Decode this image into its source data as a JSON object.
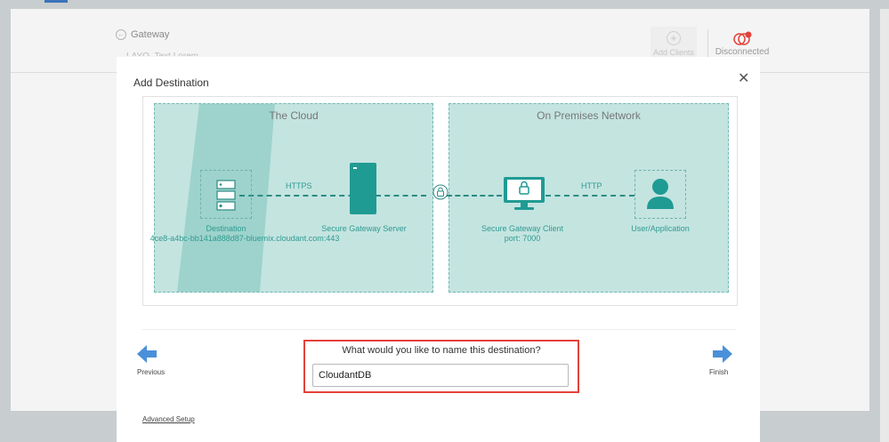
{
  "background": {
    "back_label": "Gateway",
    "subtitle_fragment": "LAYO_Text Lorem ... ",
    "add_client_label": "Add Clients",
    "status_label": "Disconnected"
  },
  "modal": {
    "title": "Add Destination",
    "close_glyph": "✕"
  },
  "diagram": {
    "cloud_zone_label": "The Cloud",
    "premises_zone_label": "On Premises Network",
    "https_label": "HTTPS",
    "http_label": "HTTP",
    "destination_label": "Destination",
    "destination_host": "4ce8-a4bc-bb141a888d87-bluemix.cloudant.com:443",
    "server_label": "Secure Gateway Server",
    "client_label": "Secure Gateway Client",
    "client_port": "port: 7000",
    "user_label": "User/Application",
    "icons": [
      "server-stack-icon",
      "gateway-server-icon",
      "lock-icon",
      "monitor-lock-icon",
      "user-icon"
    ]
  },
  "form": {
    "question": "What would you like to name this destination?",
    "name_value": "CloudantDB"
  },
  "navigation": {
    "previous_label": "Previous",
    "finish_label": "Finish",
    "advanced_label": "Advanced Setup"
  },
  "colors": {
    "accent_teal": "#2b8c84",
    "zone_fill": "#c4e4e0",
    "arrow_blue": "#4a90d9",
    "highlight_red": "#e3413b"
  }
}
